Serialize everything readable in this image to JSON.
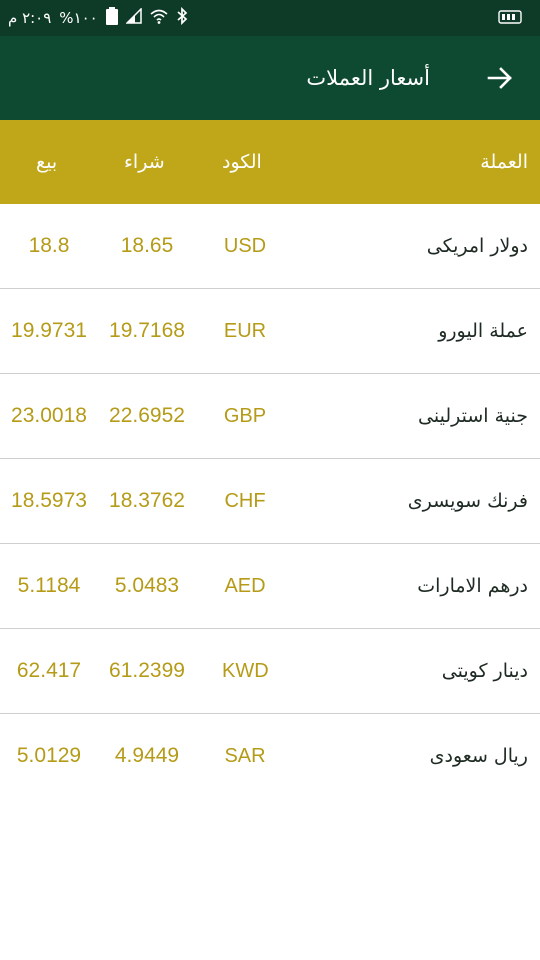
{
  "status_bar": {
    "time": "٢:٠٩ م",
    "battery_percent": "%١٠٠",
    "icons": [
      "battery-icon",
      "signal-icon",
      "wifi-icon",
      "bluetooth-icon",
      "storage-icon"
    ]
  },
  "toolbar": {
    "title": "أسعار العملات",
    "back_icon": "arrow-right-icon"
  },
  "colors": {
    "status_bar": "#0e3b27",
    "toolbar": "#0e4a31",
    "header": "#c0a71a",
    "value_text": "#b59b18"
  },
  "table": {
    "headers": {
      "currency": "العملة",
      "code": "الكود",
      "buy": "شراء",
      "sell": "بيع"
    },
    "rows": [
      {
        "name": "دولار امريكى",
        "code": "USD",
        "buy": "18.65",
        "sell": "18.8"
      },
      {
        "name": "عملة اليورو",
        "code": "EUR",
        "buy": "19.7168",
        "sell": "19.9731"
      },
      {
        "name": "جنية استرلينى",
        "code": "GBP",
        "buy": "22.6952",
        "sell": "23.0018"
      },
      {
        "name": "فرنك سويسرى",
        "code": "CHF",
        "buy": "18.3762",
        "sell": "18.5973"
      },
      {
        "name": "درهم الامارات",
        "code": "AED",
        "buy": "5.0483",
        "sell": "5.1184"
      },
      {
        "name": "دينار كويتى",
        "code": "KWD",
        "buy": "61.2399",
        "sell": "62.417"
      },
      {
        "name": "ريال سعودى",
        "code": "SAR",
        "buy": "4.9449",
        "sell": "5.0129"
      }
    ]
  }
}
